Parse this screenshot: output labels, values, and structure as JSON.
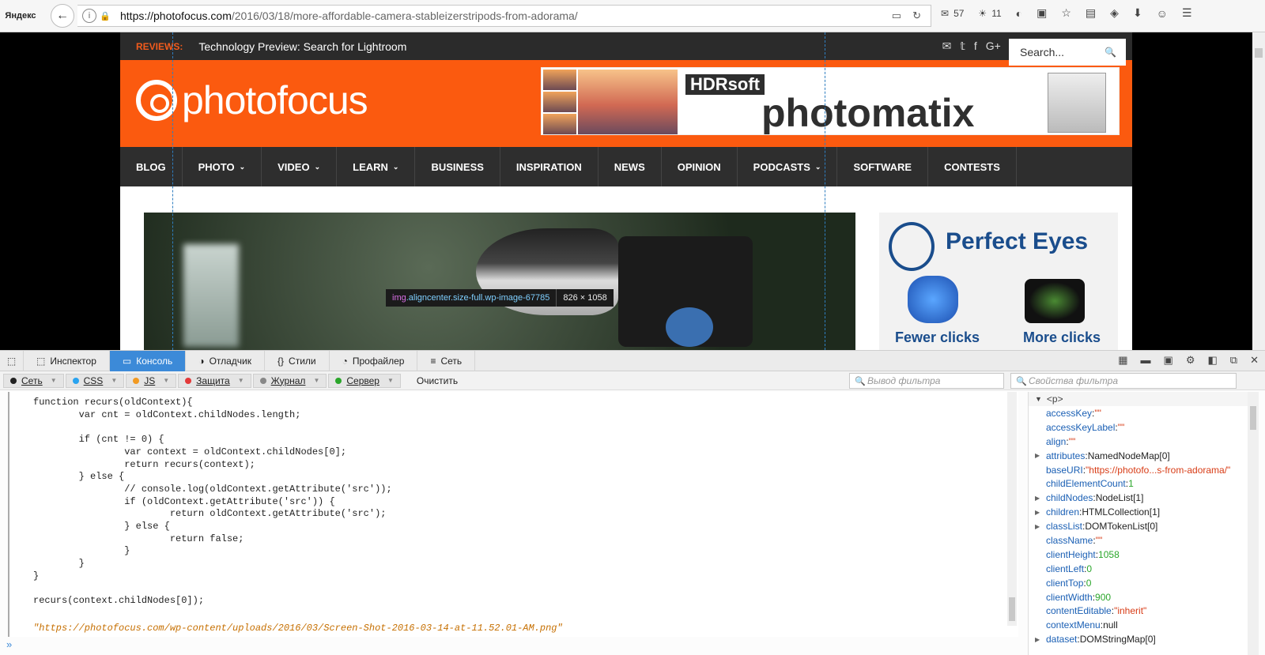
{
  "browser": {
    "logo": "Яндекс",
    "url_host": "https://photofocus.com",
    "url_path": "/2016/03/18/more-affordable-camera-stableizerstripods-from-adorama/",
    "mail_count": "57",
    "weather": "11"
  },
  "site": {
    "reviews_label": "REVIEWS:",
    "reviews_story": "Technology Preview: Search for Lightroom",
    "logo_text": "photofocus",
    "banner_brand": "HDRsoft",
    "banner_product": "photomatix",
    "nav": [
      {
        "label": "BLOG",
        "caret": false
      },
      {
        "label": "PHOTO",
        "caret": true
      },
      {
        "label": "VIDEO",
        "caret": true
      },
      {
        "label": "LEARN",
        "caret": true
      },
      {
        "label": "BUSINESS",
        "caret": false
      },
      {
        "label": "INSPIRATION",
        "caret": false
      },
      {
        "label": "NEWS",
        "caret": false
      },
      {
        "label": "OPINION",
        "caret": false
      },
      {
        "label": "PODCASTS",
        "caret": true
      },
      {
        "label": "SOFTWARE",
        "caret": false
      },
      {
        "label": "CONTESTS",
        "caret": false
      }
    ],
    "search_placeholder": "Search...",
    "tooltip_tag": "img",
    "tooltip_classes": ".aligncenter.size-full.wp-image-67785",
    "tooltip_dims": "826 × 1058",
    "ad_title": "Perfect Eyes",
    "ad_left": "Fewer clicks",
    "ad_right": "More clicks"
  },
  "devtools": {
    "tabs": [
      {
        "label": "Инспектор",
        "icon": "inspector-icon",
        "active": false
      },
      {
        "label": "Консоль",
        "icon": "console-icon",
        "active": true
      },
      {
        "label": "Отладчик",
        "icon": "debugger-icon",
        "active": false
      },
      {
        "label": "Стили",
        "icon": "style-editor-icon",
        "active": false
      },
      {
        "label": "Профайлер",
        "icon": "profiler-icon",
        "active": false
      },
      {
        "label": "Сеть",
        "icon": "network-icon",
        "active": false
      }
    ],
    "filters": [
      {
        "label": "Сеть",
        "color": "#222222"
      },
      {
        "label": "CSS",
        "color": "#29a3f0"
      },
      {
        "label": "JS",
        "color": "#f29a22"
      },
      {
        "label": "Защита",
        "color": "#e33939"
      },
      {
        "label": "Журнал",
        "color": "#888888"
      },
      {
        "label": "Сервер",
        "color": "#2aa62a"
      }
    ],
    "clear_label": "Очистить",
    "output_filter_placeholder": "Вывод фильтра",
    "props_filter_placeholder": "Свойства фильтра",
    "code": "function recurs(oldContext){\n        var cnt = oldContext.childNodes.length;\n\n        if (cnt != 0) {\n                var context = oldContext.childNodes[0];\n                return recurs(context);\n        } else {\n                // console.log(oldContext.getAttribute('src'));\n                if (oldContext.getAttribute('src')) {\n                        return oldContext.getAttribute('src');\n                } else {\n                        return false;\n                }\n        }\n}\n\nrecurs(context.childNodes[0]);",
    "result": "\"https://photofocus.com/wp-content/uploads/2016/03/Screen-Shot-2016-03-14-at-11.52.01-AM.png\"",
    "node_head": "<p>",
    "props": [
      {
        "key": "accessKey",
        "value": "\"\"",
        "type": "str",
        "expand": false
      },
      {
        "key": "accessKeyLabel",
        "value": "\"\"",
        "type": "str",
        "expand": false
      },
      {
        "key": "align",
        "value": "\"\"",
        "type": "str",
        "expand": false
      },
      {
        "key": "attributes",
        "value": "NamedNodeMap[0]",
        "type": "obj",
        "expand": true
      },
      {
        "key": "baseURI",
        "value": "\"https://photofo...s-from-adorama/\"",
        "type": "str",
        "expand": false
      },
      {
        "key": "childElementCount",
        "value": "1",
        "type": "num",
        "expand": false
      },
      {
        "key": "childNodes",
        "value": "NodeList[1]",
        "type": "obj",
        "expand": true
      },
      {
        "key": "children",
        "value": "HTMLCollection[1]",
        "type": "obj",
        "expand": true
      },
      {
        "key": "classList",
        "value": "DOMTokenList[0]",
        "type": "obj",
        "expand": true
      },
      {
        "key": "className",
        "value": "\"\"",
        "type": "str",
        "expand": false
      },
      {
        "key": "clientHeight",
        "value": "1058",
        "type": "num",
        "expand": false
      },
      {
        "key": "clientLeft",
        "value": "0",
        "type": "num",
        "expand": false
      },
      {
        "key": "clientTop",
        "value": "0",
        "type": "num",
        "expand": false
      },
      {
        "key": "clientWidth",
        "value": "900",
        "type": "num",
        "expand": false
      },
      {
        "key": "contentEditable",
        "value": "\"inherit\"",
        "type": "str",
        "expand": false
      },
      {
        "key": "contextMenu",
        "value": "null",
        "type": "obj",
        "expand": false
      },
      {
        "key": "dataset",
        "value": "DOMStringMap[0]",
        "type": "obj",
        "expand": true
      }
    ]
  }
}
